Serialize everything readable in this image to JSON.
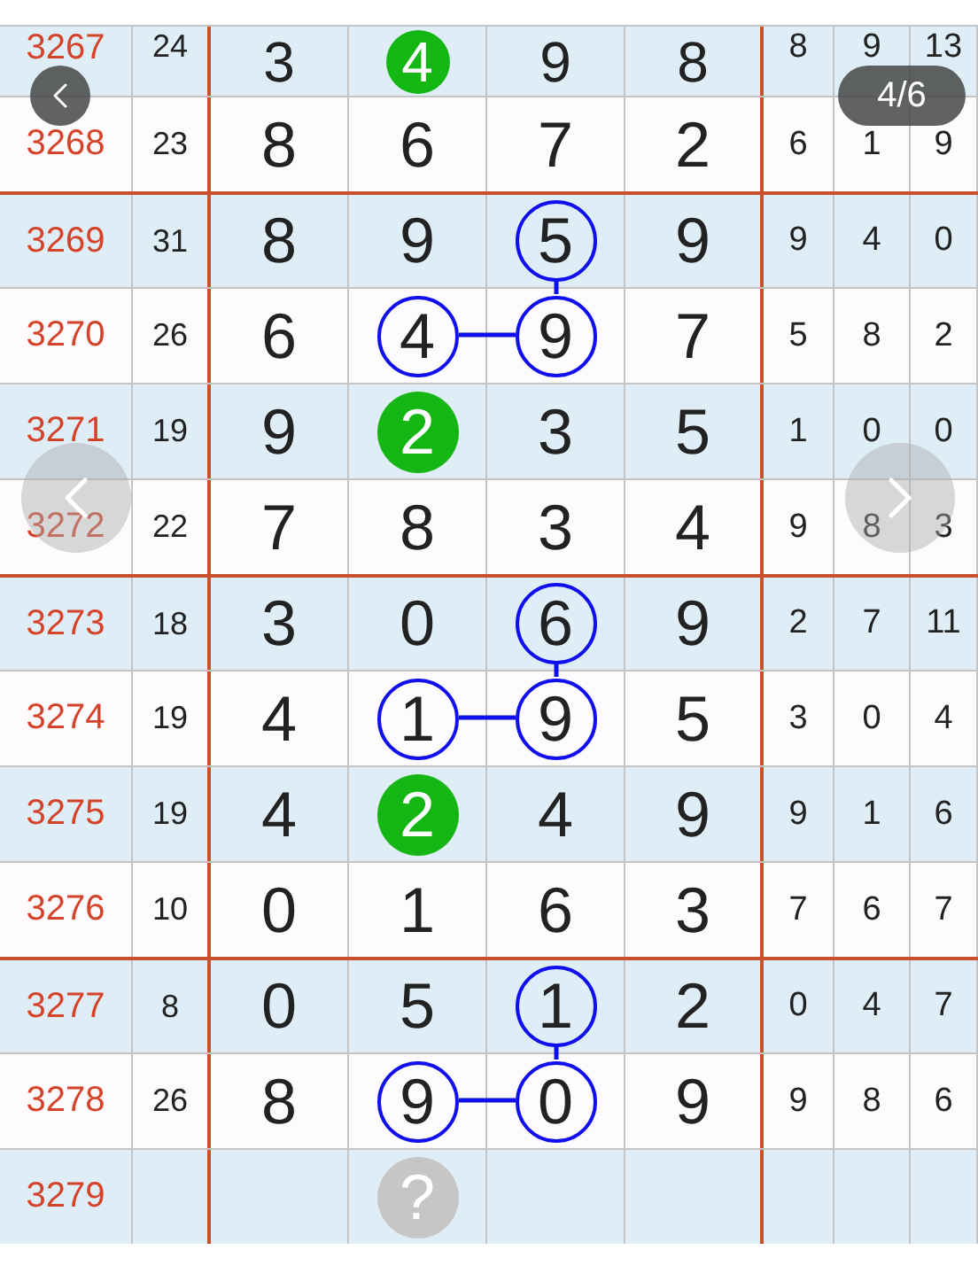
{
  "pager": {
    "label": "4/6"
  },
  "rows": [
    {
      "issue": "3267",
      "sum": "24",
      "digits": [
        {
          "value": "3",
          "kind": "plain"
        },
        {
          "value": "4",
          "kind": "ball"
        },
        {
          "value": "9",
          "kind": "plain"
        },
        {
          "value": "8",
          "kind": "plain"
        }
      ],
      "stats": [
        "8",
        "9",
        "13"
      ]
    },
    {
      "issue": "3268",
      "sum": "23",
      "digits": [
        {
          "value": "8",
          "kind": "plain"
        },
        {
          "value": "6",
          "kind": "plain"
        },
        {
          "value": "7",
          "kind": "plain"
        },
        {
          "value": "2",
          "kind": "plain"
        }
      ],
      "stats": [
        "6",
        "1",
        "9"
      ]
    },
    {
      "issue": "3269",
      "sum": "31",
      "digits": [
        {
          "value": "8",
          "kind": "plain"
        },
        {
          "value": "9",
          "kind": "plain"
        },
        {
          "value": "5",
          "kind": "circle"
        },
        {
          "value": "9",
          "kind": "plain"
        }
      ],
      "stats": [
        "9",
        "4",
        "0"
      ]
    },
    {
      "issue": "3270",
      "sum": "26",
      "digits": [
        {
          "value": "6",
          "kind": "plain"
        },
        {
          "value": "4",
          "kind": "circle"
        },
        {
          "value": "9",
          "kind": "circle"
        },
        {
          "value": "7",
          "kind": "plain"
        }
      ],
      "stats": [
        "5",
        "8",
        "2"
      ]
    },
    {
      "issue": "3271",
      "sum": "19",
      "digits": [
        {
          "value": "9",
          "kind": "plain"
        },
        {
          "value": "2",
          "kind": "ball"
        },
        {
          "value": "3",
          "kind": "plain"
        },
        {
          "value": "5",
          "kind": "plain"
        }
      ],
      "stats": [
        "1",
        "0",
        "0"
      ]
    },
    {
      "issue": "3272",
      "sum": "22",
      "digits": [
        {
          "value": "7",
          "kind": "plain"
        },
        {
          "value": "8",
          "kind": "plain"
        },
        {
          "value": "3",
          "kind": "plain"
        },
        {
          "value": "4",
          "kind": "plain"
        }
      ],
      "stats": [
        "9",
        "8",
        "3"
      ]
    },
    {
      "issue": "3273",
      "sum": "18",
      "digits": [
        {
          "value": "3",
          "kind": "plain"
        },
        {
          "value": "0",
          "kind": "plain"
        },
        {
          "value": "6",
          "kind": "circle"
        },
        {
          "value": "9",
          "kind": "plain"
        }
      ],
      "stats": [
        "2",
        "7",
        "11"
      ]
    },
    {
      "issue": "3274",
      "sum": "19",
      "digits": [
        {
          "value": "4",
          "kind": "plain"
        },
        {
          "value": "1",
          "kind": "circle"
        },
        {
          "value": "9",
          "kind": "circle"
        },
        {
          "value": "5",
          "kind": "plain"
        }
      ],
      "stats": [
        "3",
        "0",
        "4"
      ]
    },
    {
      "issue": "3275",
      "sum": "19",
      "digits": [
        {
          "value": "4",
          "kind": "plain"
        },
        {
          "value": "2",
          "kind": "ball"
        },
        {
          "value": "4",
          "kind": "plain"
        },
        {
          "value": "9",
          "kind": "plain"
        }
      ],
      "stats": [
        "9",
        "1",
        "6"
      ]
    },
    {
      "issue": "3276",
      "sum": "10",
      "digits": [
        {
          "value": "0",
          "kind": "plain"
        },
        {
          "value": "1",
          "kind": "plain"
        },
        {
          "value": "6",
          "kind": "plain"
        },
        {
          "value": "3",
          "kind": "plain"
        }
      ],
      "stats": [
        "7",
        "6",
        "7"
      ]
    },
    {
      "issue": "3277",
      "sum": "8",
      "digits": [
        {
          "value": "0",
          "kind": "plain"
        },
        {
          "value": "5",
          "kind": "plain"
        },
        {
          "value": "1",
          "kind": "circle"
        },
        {
          "value": "2",
          "kind": "plain"
        }
      ],
      "stats": [
        "0",
        "4",
        "7"
      ]
    },
    {
      "issue": "3278",
      "sum": "26",
      "digits": [
        {
          "value": "8",
          "kind": "plain"
        },
        {
          "value": "9",
          "kind": "circle"
        },
        {
          "value": "0",
          "kind": "circle"
        },
        {
          "value": "9",
          "kind": "plain"
        }
      ],
      "stats": [
        "9",
        "8",
        "6"
      ]
    },
    {
      "issue": "3279",
      "digits": [
        {
          "kind": "empty"
        },
        {
          "value": "?",
          "kind": "pending"
        },
        {
          "kind": "empty"
        },
        {
          "kind": "empty"
        }
      ]
    }
  ]
}
